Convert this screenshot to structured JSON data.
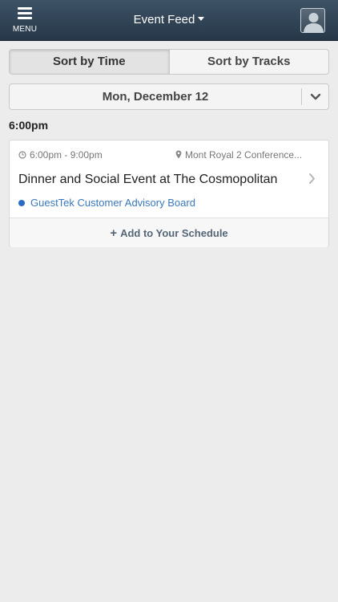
{
  "header": {
    "menu_label": "MENU",
    "title": "Event Feed",
    "colors": {
      "bar_top": "#3e5266",
      "bar_bottom": "#263848"
    }
  },
  "sort": {
    "by_time": "Sort by Time",
    "by_tracks": "Sort by Tracks",
    "active": "by_time"
  },
  "date_selector": {
    "selected": "Mon, December 12"
  },
  "schedule": {
    "time_heading": "6:00pm",
    "events": [
      {
        "time_range": "6:00pm - 9:00pm",
        "location": "Mont Royal 2 Conference...",
        "title": "Dinner and Social Event at The Cosmopolitan",
        "track": "GuestTek Customer Advisory Board",
        "track_color": "#2a6cc4",
        "add_label": "Add to Your Schedule",
        "add_icon": "+"
      }
    ]
  },
  "icons": {
    "menu": "hamburger-icon",
    "dropdown": "caret-down-icon",
    "profile": "user-avatar-icon",
    "date_toggle": "chevron-down-icon",
    "time": "clock-icon",
    "location": "map-pin-icon",
    "open_event": "chevron-right-icon",
    "add": "plus-icon"
  }
}
